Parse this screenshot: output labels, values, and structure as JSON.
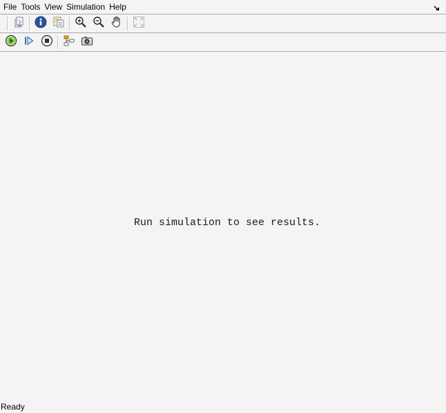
{
  "menubar": {
    "items": [
      "File",
      "Tools",
      "View",
      "Simulation",
      "Help"
    ],
    "undock_icon": "undock-arrow-icon"
  },
  "toolbar1": {
    "buttons": [
      {
        "icon": "print-icon"
      },
      {
        "icon": "info-icon"
      },
      {
        "icon": "block-parameters-icon"
      },
      {
        "icon": "zoom-in-icon"
      },
      {
        "icon": "zoom-out-icon"
      },
      {
        "icon": "pan-hand-icon"
      },
      {
        "icon": "fit-to-view-icon"
      }
    ]
  },
  "toolbar2": {
    "buttons": [
      {
        "icon": "run-icon"
      },
      {
        "icon": "step-forward-icon"
      },
      {
        "icon": "stop-icon"
      },
      {
        "icon": "model-hierarchy-icon"
      },
      {
        "icon": "snapshot-camera-icon"
      }
    ]
  },
  "content": {
    "message": "Run simulation to see results."
  },
  "statusbar": {
    "text": "Ready"
  },
  "colors": {
    "background": "#f4f4f4",
    "run_green": "#3aa21a",
    "info_blue": "#2a5599"
  }
}
